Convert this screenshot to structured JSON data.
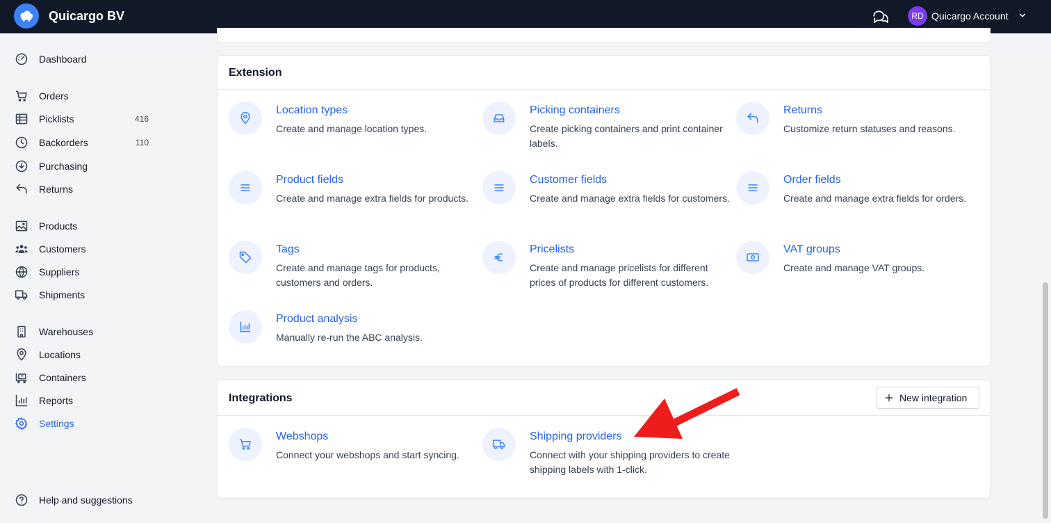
{
  "header": {
    "brand": "Quicargo BV",
    "avatar_initials": "RD",
    "account_name": "Quicargo Account"
  },
  "sidebar": {
    "items": [
      {
        "label": "Dashboard",
        "icon": "dashboard-icon"
      },
      {
        "label": "Orders",
        "icon": "cart-icon"
      },
      {
        "label": "Picklists",
        "icon": "table-icon",
        "count": "416"
      },
      {
        "label": "Backorders",
        "icon": "clock-icon",
        "count": "110"
      },
      {
        "label": "Purchasing",
        "icon": "download-circle-icon"
      },
      {
        "label": "Returns",
        "icon": "return-arrow-icon"
      },
      {
        "label": "Products",
        "icon": "image-icon"
      },
      {
        "label": "Customers",
        "icon": "users-icon"
      },
      {
        "label": "Suppliers",
        "icon": "globe-icon"
      },
      {
        "label": "Shipments",
        "icon": "truck-icon"
      },
      {
        "label": "Warehouses",
        "icon": "building-icon"
      },
      {
        "label": "Locations",
        "icon": "map-pin-icon"
      },
      {
        "label": "Containers",
        "icon": "container-icon"
      },
      {
        "label": "Reports",
        "icon": "bar-chart-icon"
      },
      {
        "label": "Settings",
        "icon": "gear-icon"
      }
    ],
    "help": "Help and suggestions"
  },
  "extension": {
    "title": "Extension",
    "tiles": [
      {
        "title": "Location types",
        "desc": "Create and manage location types.",
        "icon": "map-pin-icon"
      },
      {
        "title": "Picking containers",
        "desc": "Create picking containers and print container labels.",
        "icon": "inbox-icon"
      },
      {
        "title": "Returns",
        "desc": "Customize return statuses and reasons.",
        "icon": "return-arrow-icon"
      },
      {
        "title": "Product fields",
        "desc": "Create and manage extra fields for products.",
        "icon": "list-icon"
      },
      {
        "title": "Customer fields",
        "desc": "Create and manage extra fields for customers.",
        "icon": "list-icon"
      },
      {
        "title": "Order fields",
        "desc": "Create and manage extra fields for orders.",
        "icon": "list-icon"
      },
      {
        "title": "Tags",
        "desc": "Create and manage tags for products, customers and orders.",
        "icon": "tag-icon"
      },
      {
        "title": "Pricelists",
        "desc": "Create and manage pricelists for different prices of products for different customers.",
        "icon": "euro-icon"
      },
      {
        "title": "VAT groups",
        "desc": "Create and manage VAT groups.",
        "icon": "banknote-icon"
      },
      {
        "title": "Product analysis",
        "desc": "Manually re-run the ABC analysis.",
        "icon": "chart-icon"
      }
    ]
  },
  "integrations": {
    "title": "Integrations",
    "new_button": "New integration",
    "tiles": [
      {
        "title": "Webshops",
        "desc": "Connect your webshops and start syncing.",
        "icon": "cart-icon"
      },
      {
        "title": "Shipping providers",
        "desc": "Connect with your shipping providers to create shipping labels with 1-click.",
        "icon": "truck-icon"
      }
    ]
  },
  "colors": {
    "topbar": "#111827",
    "accent": "#2563eb",
    "icon_bg": "#eef2ff",
    "annotation_arrow": "#ef1c1c"
  }
}
